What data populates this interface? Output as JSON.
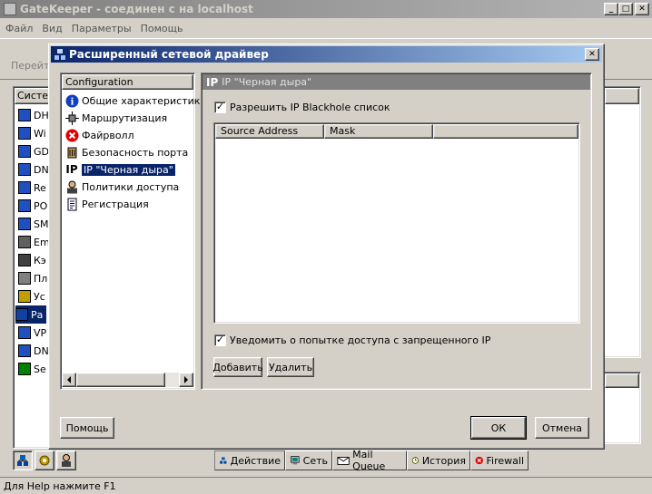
{
  "main_window": {
    "title": "GateKeeper - соединен с на localhost",
    "menu": [
      "Файл",
      "Вид",
      "Параметры",
      "Помощь"
    ],
    "toolbar_label": "Перейт",
    "left_header": "Систем",
    "left_items": [
      "DH",
      "Wi",
      "GD",
      "DN",
      "Re",
      "PO",
      "SM",
      "Em",
      "Кэ",
      "Пл",
      "Ус",
      "Ра",
      "VP",
      "DN",
      "Se"
    ],
    "status_text": "Для Help нажмите F1",
    "tabs": [
      "Действие",
      "Сеть",
      "Mail Queue",
      "История",
      "Firewall"
    ]
  },
  "dialog": {
    "title": "Расширенный сетевой драйвер",
    "tree_header": "Configuration",
    "tree_items": [
      "Общие характеристики",
      "Маршрутизация",
      "Файрволл",
      "Безопасность порта",
      "IP \"Черная дыра\"",
      "Политики доступа",
      "Регистрация"
    ],
    "panel_icon_text": "IP",
    "panel_title": "IP \"Черная дыра\"",
    "enable_checkbox_label": "Разрешить IP Blackhole список",
    "enable_checked": true,
    "columns": [
      "Source Address",
      "Mask"
    ],
    "notify_checkbox_label": "Уведомить о попытке доступа с запрещенного IP",
    "notify_checked": true,
    "add_label": "Добавить",
    "delete_label": "Удалить",
    "help_label": "Помощь",
    "ok_label": "ОК",
    "cancel_label": "Отмена"
  },
  "colors": {
    "active_title": "#0a246a",
    "inactive_title": "#808080",
    "selection": "#0a246a",
    "face": "#d4d0c8"
  }
}
